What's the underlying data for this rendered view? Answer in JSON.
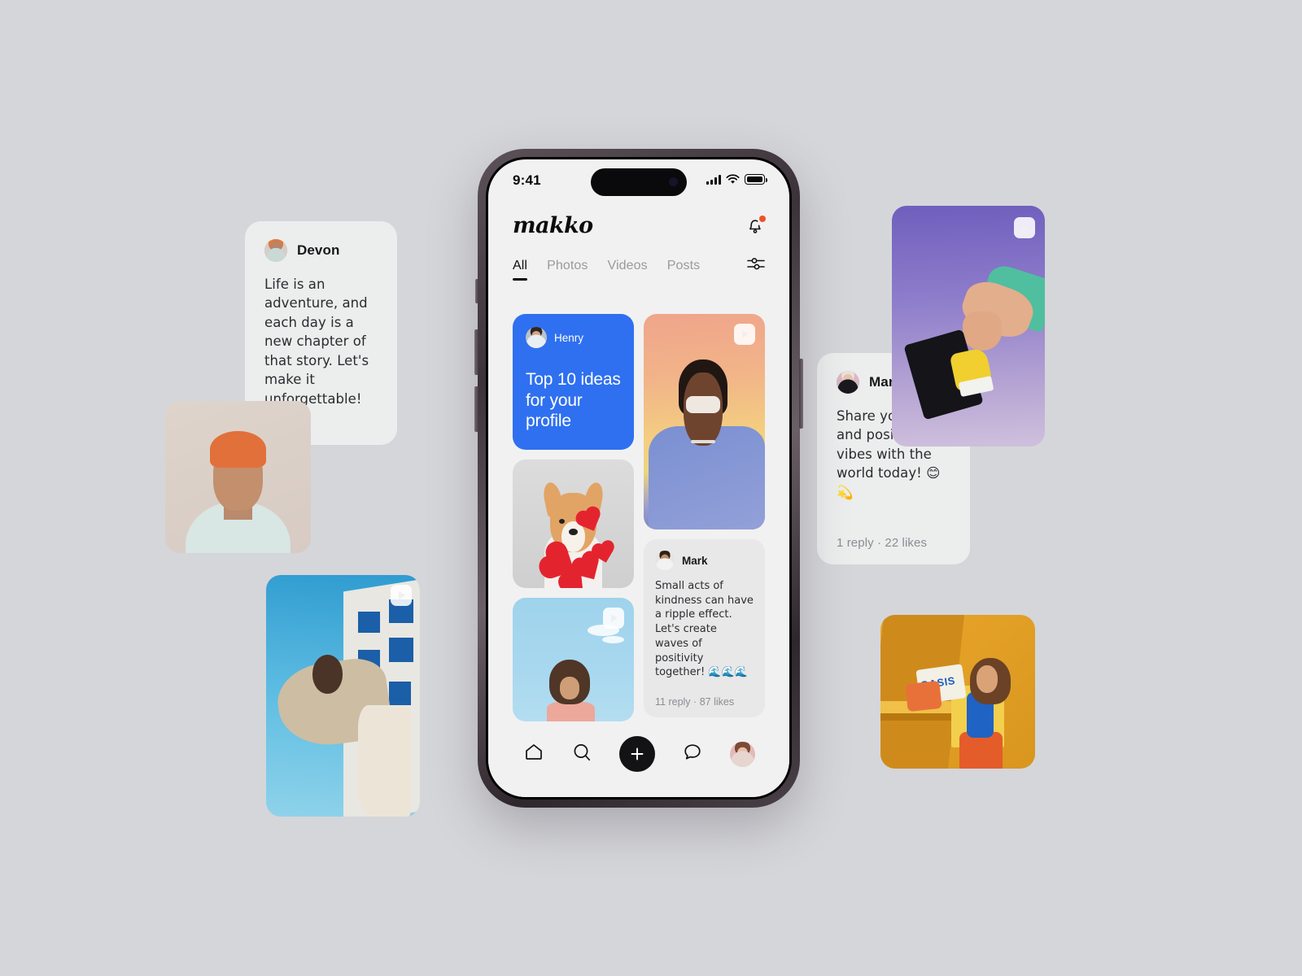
{
  "background_color": "#d5d6da",
  "phone": {
    "status_bar": {
      "time": "9:41",
      "signal_icon": "cellular-bars-icon",
      "wifi_icon": "wifi-icon",
      "battery_icon": "battery-icon"
    },
    "header": {
      "logo": "makko",
      "notification_icon": "bell-icon",
      "has_notification_dot": true
    },
    "tabs": [
      {
        "label": "All",
        "active": true
      },
      {
        "label": "Photos",
        "active": false
      },
      {
        "label": "Videos",
        "active": false
      },
      {
        "label": "Posts",
        "active": false
      }
    ],
    "filter_icon": "sliders-filter-icon",
    "promo_card": {
      "author": "Henry",
      "title": "Top 10 ideas for your profile",
      "background_color": "#2f70f0"
    },
    "inner_comment": {
      "author": "Mark",
      "text": "Small acts of kindness can have a ripple effect. Let's create waves of positivity together! 🌊🌊🌊",
      "replies": "11 reply",
      "separator": "·",
      "likes": "87 likes"
    },
    "media_tiles": [
      {
        "name": "person-sunglasses-video",
        "has_play_badge": true
      },
      {
        "name": "corgi-hearts-photo",
        "has_play_badge": false
      },
      {
        "name": "sky-portrait-video",
        "has_play_badge": true
      },
      {
        "name": "purple-arch-photo",
        "has_play_badge": false
      }
    ],
    "bottom_nav": [
      {
        "name": "home",
        "icon": "home-icon"
      },
      {
        "name": "search",
        "icon": "search-icon"
      },
      {
        "name": "create",
        "icon": "plus-icon"
      },
      {
        "name": "messages",
        "icon": "chat-bubble-icon"
      },
      {
        "name": "profile",
        "icon": "avatar-icon"
      }
    ]
  },
  "floating_cards": [
    {
      "id": "devon",
      "author": "Devon",
      "text": "Life is an adventure, and each day is a new chapter of that story. Let's make it unforgettable! 🌟🌺",
      "meta": null
    },
    {
      "id": "mariane",
      "author": "Mariane",
      "text": "Share your smile and positive vibes with the world today! 😊💫",
      "replies": "1 reply",
      "separator": "·",
      "likes": "22 likes"
    }
  ],
  "floating_media": [
    {
      "id": "orange-hair-portrait",
      "has_play_badge": false
    },
    {
      "id": "sky-building-jump-video",
      "has_play_badge": true
    },
    {
      "id": "purple-hand-phone-video",
      "has_play_badge": true
    },
    {
      "id": "oasis-yellow-photo",
      "has_play_badge": false,
      "sign_text": "OASIS"
    }
  ]
}
